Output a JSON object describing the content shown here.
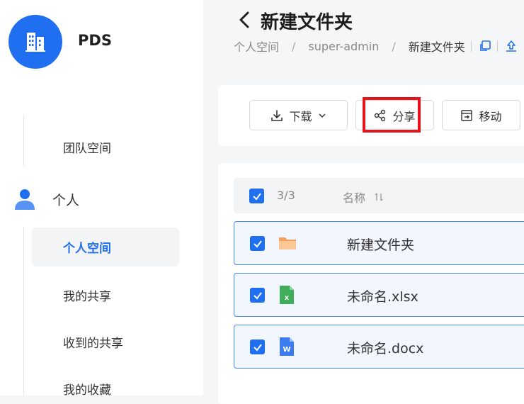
{
  "app": {
    "name": "PDS"
  },
  "sidebar": {
    "team_space": "团队空间",
    "personal": "个人",
    "items": [
      {
        "label": "个人空间",
        "active": true
      },
      {
        "label": "我的共享"
      },
      {
        "label": "收到的共享"
      },
      {
        "label": "我的收藏"
      }
    ]
  },
  "header": {
    "title": "新建文件夹",
    "breadcrumb": [
      "个人空间",
      "super-admin",
      "新建文件夹"
    ],
    "separator": "/"
  },
  "toolbar": {
    "download": "下载",
    "share": "分享",
    "move": "移动"
  },
  "list": {
    "selected_count": "3/3",
    "name_column": "名称",
    "files": [
      {
        "name": "新建文件夹",
        "type": "folder",
        "icon": "folder-icon"
      },
      {
        "name": "未命名.xlsx",
        "type": "xlsx",
        "icon": "excel-file-icon"
      },
      {
        "name": "未命名.docx",
        "type": "docx",
        "icon": "word-file-icon"
      }
    ]
  },
  "colors": {
    "accent": "#1f6ff0",
    "highlight": "#e8121b",
    "row_bg": "#f2f6ff",
    "folder": "#f5a05a",
    "excel": "#3fae5b",
    "word": "#3b7cf0"
  }
}
